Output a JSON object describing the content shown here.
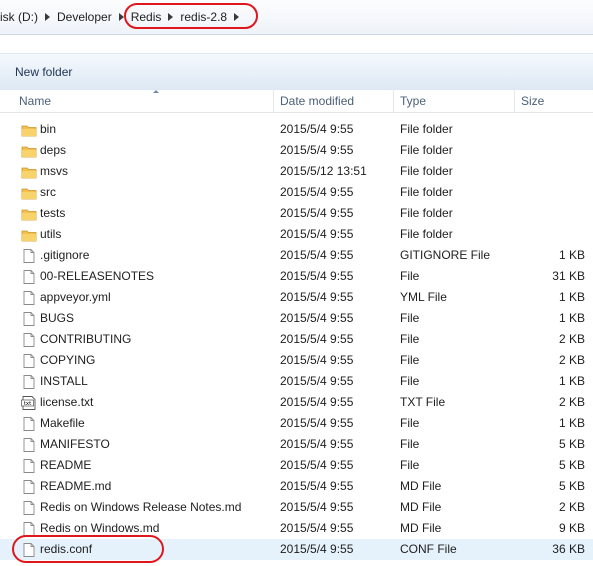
{
  "breadcrumb": {
    "items": [
      "isk (D:)",
      "Developer",
      "Redis",
      "redis-2.8"
    ]
  },
  "toolbar": {
    "new_folder_label": "New folder"
  },
  "columns": {
    "name": "Name",
    "date": "Date modified",
    "type": "Type",
    "size": "Size"
  },
  "files": [
    {
      "name": "bin",
      "date": "2015/5/4 9:55",
      "type": "File folder",
      "size": "",
      "icon": "folder-icon"
    },
    {
      "name": "deps",
      "date": "2015/5/4 9:55",
      "type": "File folder",
      "size": "",
      "icon": "folder-icon"
    },
    {
      "name": "msvs",
      "date": "2015/5/12 13:51",
      "type": "File folder",
      "size": "",
      "icon": "folder-icon"
    },
    {
      "name": "src",
      "date": "2015/5/4 9:55",
      "type": "File folder",
      "size": "",
      "icon": "folder-icon"
    },
    {
      "name": "tests",
      "date": "2015/5/4 9:55",
      "type": "File folder",
      "size": "",
      "icon": "folder-icon"
    },
    {
      "name": "utils",
      "date": "2015/5/4 9:55",
      "type": "File folder",
      "size": "",
      "icon": "folder-icon"
    },
    {
      "name": ".gitignore",
      "date": "2015/5/4 9:55",
      "type": "GITIGNORE File",
      "size": "1 KB",
      "icon": "file-icon"
    },
    {
      "name": "00-RELEASENOTES",
      "date": "2015/5/4 9:55",
      "type": "File",
      "size": "31 KB",
      "icon": "file-icon"
    },
    {
      "name": "appveyor.yml",
      "date": "2015/5/4 9:55",
      "type": "YML File",
      "size": "1 KB",
      "icon": "file-icon"
    },
    {
      "name": "BUGS",
      "date": "2015/5/4 9:55",
      "type": "File",
      "size": "1 KB",
      "icon": "file-icon"
    },
    {
      "name": "CONTRIBUTING",
      "date": "2015/5/4 9:55",
      "type": "File",
      "size": "2 KB",
      "icon": "file-icon"
    },
    {
      "name": "COPYING",
      "date": "2015/5/4 9:55",
      "type": "File",
      "size": "2 KB",
      "icon": "file-icon"
    },
    {
      "name": "INSTALL",
      "date": "2015/5/4 9:55",
      "type": "File",
      "size": "1 KB",
      "icon": "file-icon"
    },
    {
      "name": "license.txt",
      "date": "2015/5/4 9:55",
      "type": "TXT File",
      "size": "2 KB",
      "icon": "text-file-icon"
    },
    {
      "name": "Makefile",
      "date": "2015/5/4 9:55",
      "type": "File",
      "size": "1 KB",
      "icon": "file-icon"
    },
    {
      "name": "MANIFESTO",
      "date": "2015/5/4 9:55",
      "type": "File",
      "size": "5 KB",
      "icon": "file-icon"
    },
    {
      "name": "README",
      "date": "2015/5/4 9:55",
      "type": "File",
      "size": "5 KB",
      "icon": "file-icon"
    },
    {
      "name": "README.md",
      "date": "2015/5/4 9:55",
      "type": "MD File",
      "size": "5 KB",
      "icon": "file-icon"
    },
    {
      "name": "Redis on Windows Release Notes.md",
      "date": "2015/5/4 9:55",
      "type": "MD File",
      "size": "2 KB",
      "icon": "file-icon"
    },
    {
      "name": "Redis on Windows.md",
      "date": "2015/5/4 9:55",
      "type": "MD File",
      "size": "9 KB",
      "icon": "file-icon"
    },
    {
      "name": "redis.conf",
      "date": "2015/5/4 9:55",
      "type": "CONF File",
      "size": "36 KB",
      "icon": "file-icon",
      "selected": true
    }
  ],
  "colors": {
    "highlight": "#e0161d",
    "selection": "#e5f1fb",
    "folder": "#f3c04f"
  }
}
